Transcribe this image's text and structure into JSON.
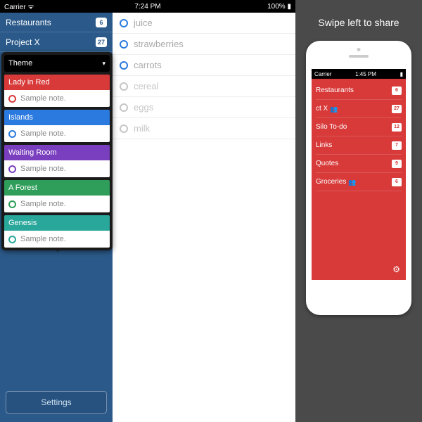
{
  "ipad": {
    "statusbar": {
      "carrier": "Carrier",
      "wifi": "≈",
      "time": "7:24 PM",
      "battery": "100%"
    },
    "sidebar": {
      "rows": [
        {
          "label": "Restaurants",
          "count": "6"
        },
        {
          "label": "Project X",
          "count": "27"
        }
      ],
      "settings_label": "Settings"
    },
    "main": {
      "items": [
        {
          "label": "juice",
          "done": false
        },
        {
          "label": "strawberries",
          "done": false
        },
        {
          "label": "carrots",
          "done": false
        },
        {
          "label": "cereal",
          "done": true
        },
        {
          "label": "eggs",
          "done": true
        },
        {
          "label": "milk",
          "done": true
        }
      ]
    },
    "popover": {
      "header": "Theme",
      "themes": [
        {
          "name": "Lady in Red",
          "note": "Sample note.",
          "color": "#d83a3a"
        },
        {
          "name": "Islands",
          "note": "Sample note.",
          "color": "#2b7adf"
        },
        {
          "name": "Waiting Room",
          "note": "Sample note.",
          "color": "#7a3fbf"
        },
        {
          "name": "A Forest",
          "note": "Sample note.",
          "color": "#2f9e5a"
        },
        {
          "name": "Genesis",
          "note": "Sample note.",
          "color": "#2aa79b"
        }
      ]
    }
  },
  "phone": {
    "instruction": "Swipe left to share",
    "statusbar": {
      "carrier": "Carrier",
      "time": "1:45 PM"
    },
    "rows": [
      {
        "label": "Restaurants",
        "count": "6",
        "shared": false
      },
      {
        "label": "ct X",
        "count": "27",
        "shared": true
      },
      {
        "label": "Silo To-do",
        "count": "12",
        "shared": false
      },
      {
        "label": "Links",
        "count": "7",
        "shared": false
      },
      {
        "label": "Quotes",
        "count": "9",
        "shared": false
      },
      {
        "label": "Groceries",
        "count": "6",
        "shared": true
      }
    ]
  }
}
